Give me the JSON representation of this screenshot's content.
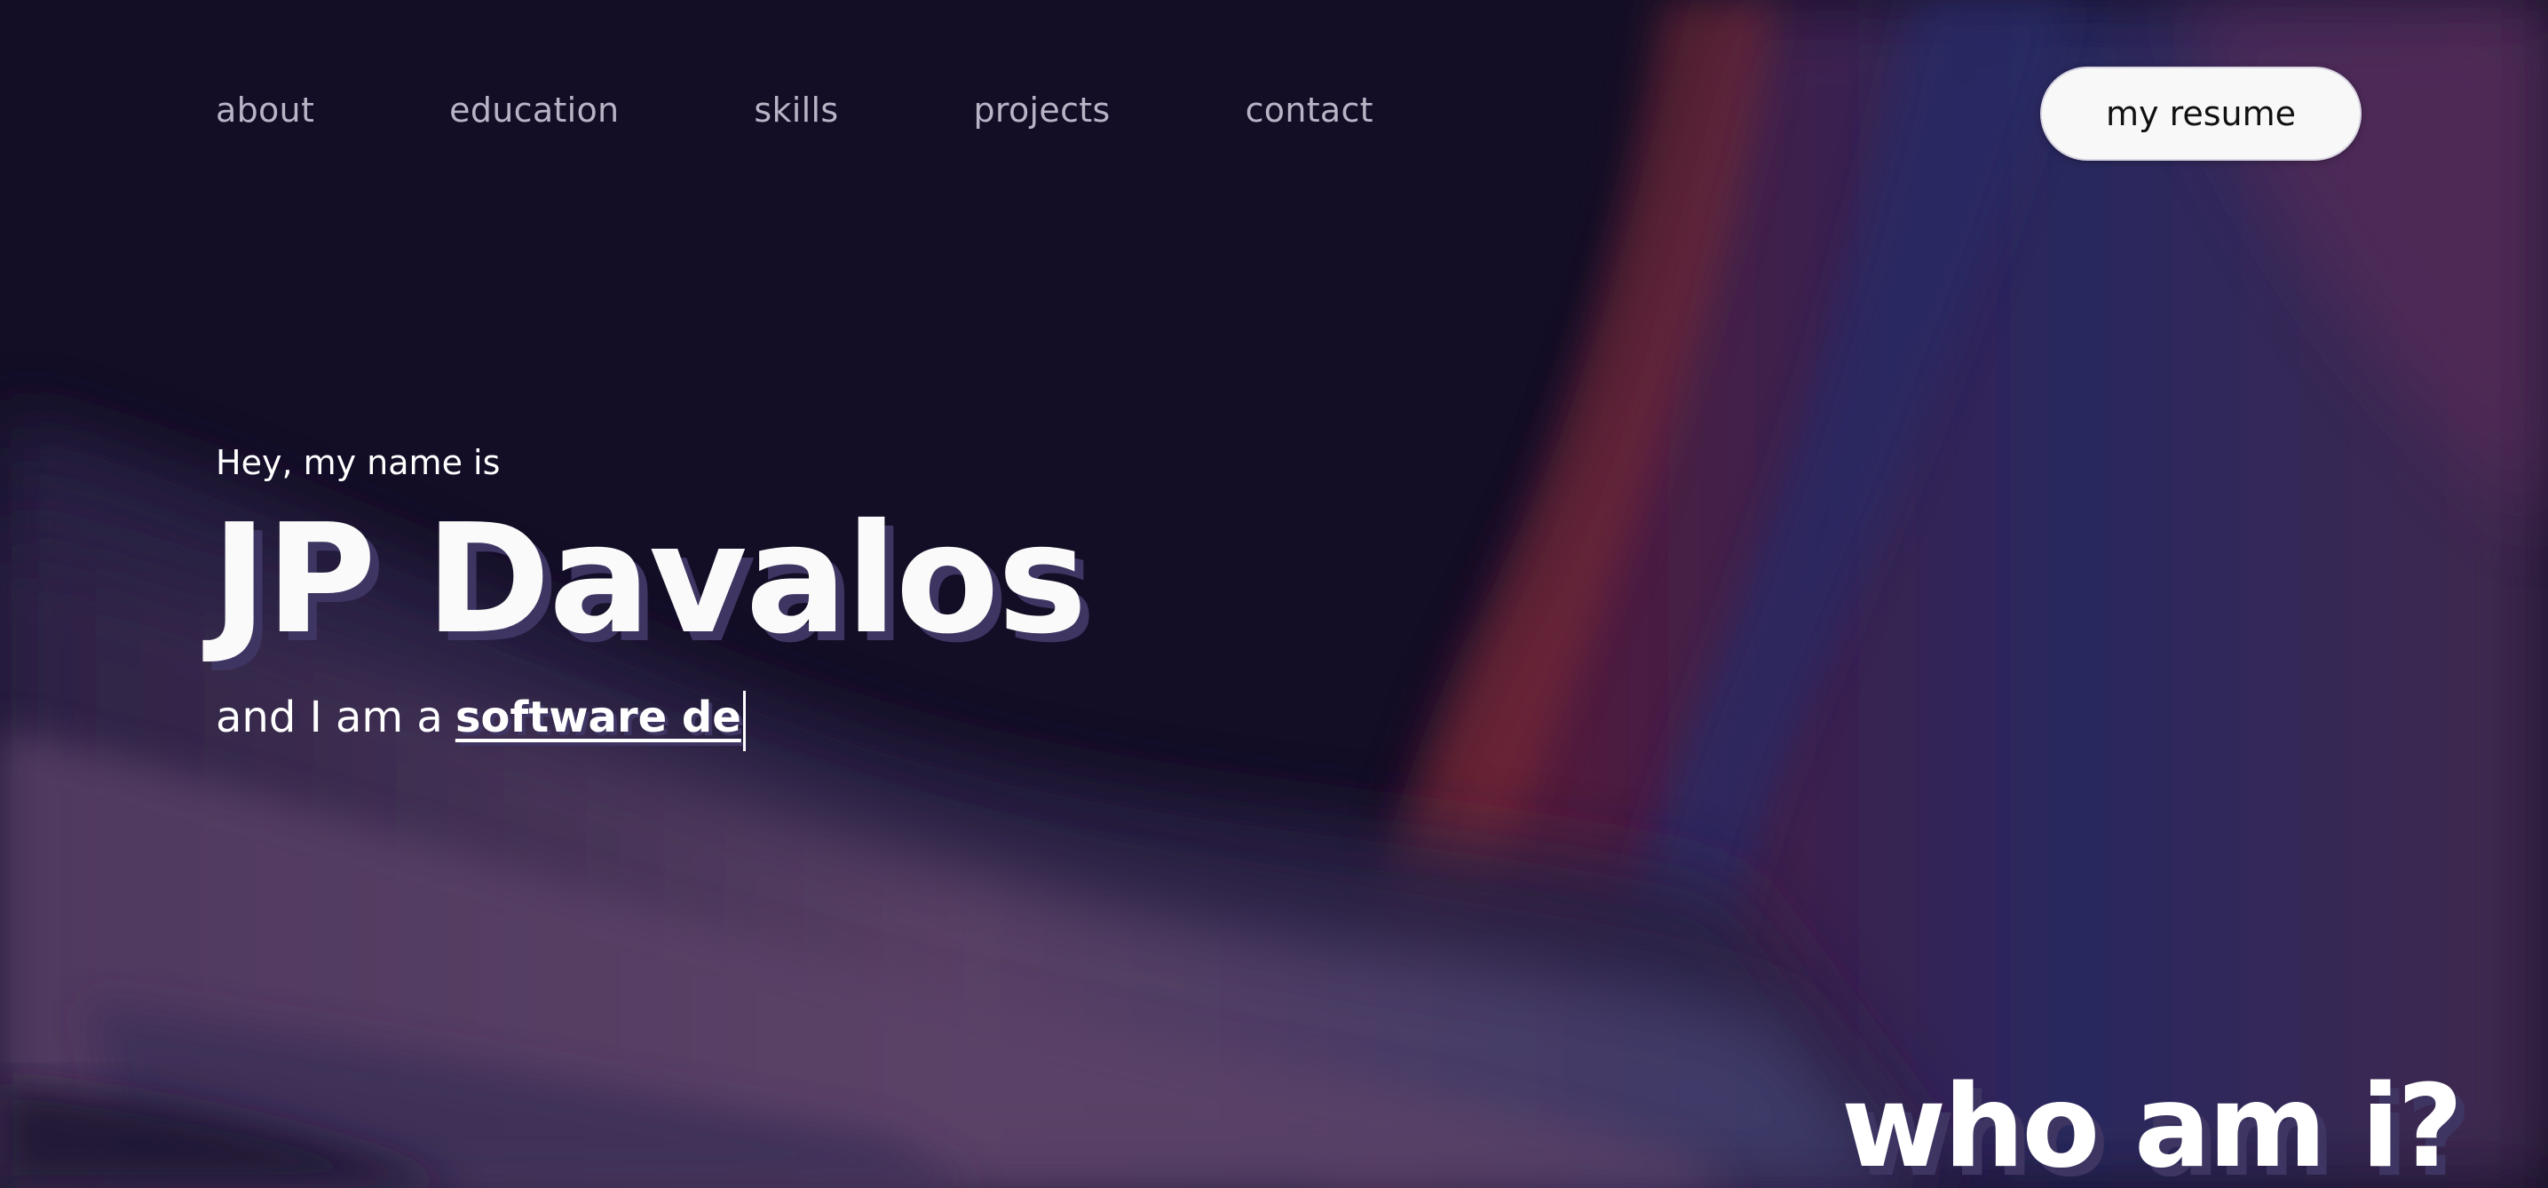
{
  "nav": {
    "items": [
      {
        "label": "about"
      },
      {
        "label": "education"
      },
      {
        "label": "skills"
      },
      {
        "label": "projects"
      },
      {
        "label": "contact"
      }
    ],
    "resume_label": "my resume"
  },
  "hero": {
    "intro": "Hey, my name is",
    "name": "JP Davalos",
    "tagline_prefix": "and I am a",
    "typed_text": "software de"
  },
  "about": {
    "heading": "who am i?"
  },
  "colors": {
    "background": "#130e26",
    "text": "#ffffff",
    "shadow": "#3f3562",
    "button_bg": "#f8f8f8"
  }
}
